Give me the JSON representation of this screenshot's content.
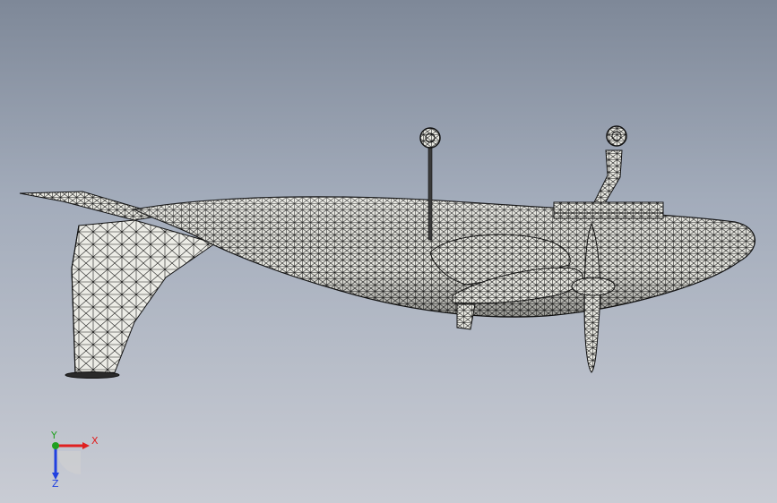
{
  "axes": {
    "x_label": "X",
    "y_label": "Y",
    "z_label": "Z",
    "x_color": "#e02020",
    "y_color": "#20a020",
    "z_color": "#2040e0"
  },
  "colors": {
    "background_top": "#7e8898",
    "background_bottom": "#c9ccd4",
    "mesh_fill": "#e9e9e2",
    "mesh_line": "#1a1a1a"
  }
}
